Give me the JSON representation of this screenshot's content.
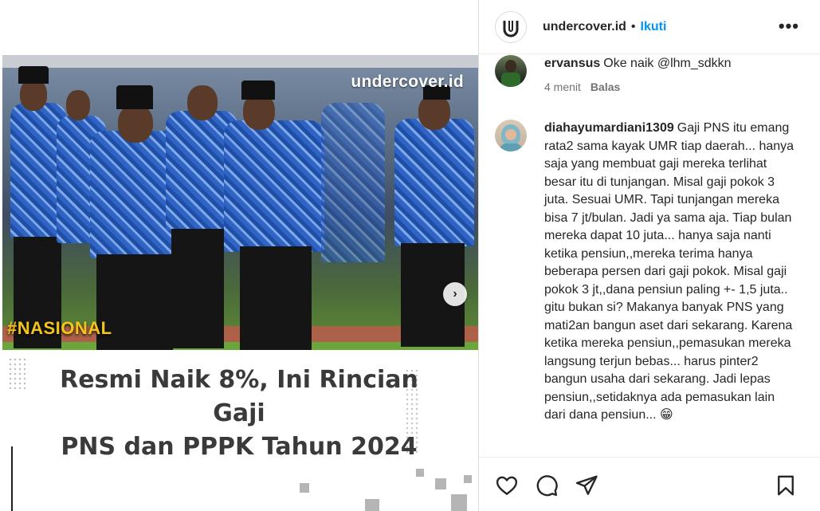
{
  "post": {
    "watermark": "undercover.id",
    "tag": "#NASIONAL",
    "headline_line1": "Resmi Naik 8%, Ini Rincian Gaji",
    "headline_line2": "PNS dan PPPK Tahun 2024",
    "next_icon": "chevron-right-icon"
  },
  "header": {
    "username": "undercover.id",
    "separator": "•",
    "follow_label": "Ikuti",
    "more_label": "•••"
  },
  "comments": [
    {
      "username": "ervansus",
      "text": "Oke naik @lhm_sdkkn",
      "time": "4 menit",
      "reply_label": "Balas"
    },
    {
      "username": "diahayumardiani1309",
      "text": "Gaji PNS itu emang rata2 sama kayak UMR tiap daerah... hanya saja yang membuat gaji mereka terlihat besar itu di tunjangan. Misal gaji pokok 3 juta. Sesuai UMR. Tapi tunjangan mereka bisa 7 jt/bulan. Jadi ya sama aja. Tiap bulan mereka dapat 10 juta... hanya saja nanti ketika pensiun,,mereka terima hanya beberapa persen dari gaji pokok. Misal gaji pokok 3 jt,,dana pensiun paling +- 1,5 juta.. gitu bukan si? Makanya banyak PNS yang mati2an bangun aset dari sekarang. Karena ketika mereka pensiun,,pemasukan mereka langsung terjun bebas... harus pinter2 bangun usaha dari sekarang. Jadi lepas pensiun,,setidaknya ada pemasukan lain dari dana pensiun... 😁"
    }
  ],
  "actions": {
    "like_icon": "heart-icon",
    "comment_icon": "comment-icon",
    "share_icon": "share-icon",
    "save_icon": "bookmark-icon"
  },
  "colors": {
    "accent": "#0095f6",
    "text": "#262626",
    "muted": "#737373",
    "tag_yellow": "#f3c51a"
  }
}
